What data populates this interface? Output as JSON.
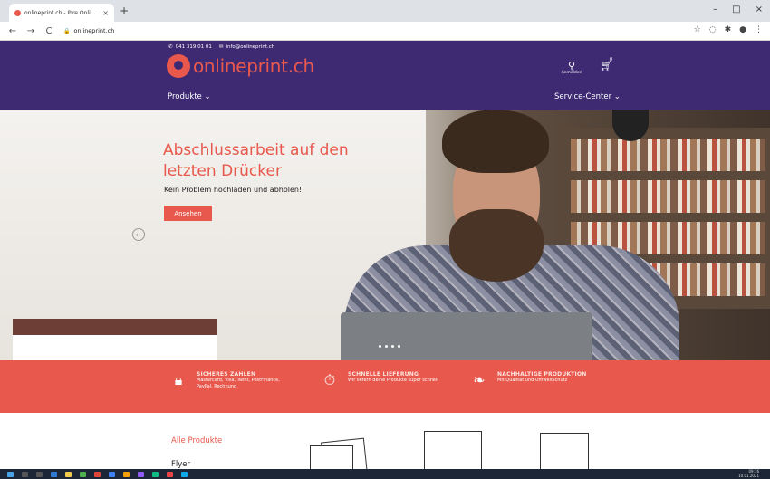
{
  "browser": {
    "tab_title": "onlineprint.ch - Ihre Onlinedruck",
    "tab_close": "×",
    "new_tab": "+",
    "url": "onlineprint.ch",
    "window_controls": [
      "–",
      "□",
      "×"
    ]
  },
  "header": {
    "phone": "041 319 01 01",
    "email": "info@onlineprint.ch",
    "logo_text": "onlineprint.ch",
    "account_label": "Anmelden",
    "cart_count": "0",
    "menu_products": "Produkte ⌄",
    "menu_service": "Service-Center ⌄"
  },
  "hero": {
    "title": "Abschlussarbeit auf den letzten Drücker",
    "subtitle": "Kein Problem hochladen und abholen!",
    "button": "Ansehen"
  },
  "features": [
    {
      "icon": "lock-icon",
      "title": "SICHERES ZAHLEN",
      "text": "Mastercard, Visa, Twint, PostFinance, PayPal, Rechnung"
    },
    {
      "icon": "stopwatch-icon",
      "title": "SCHNELLE LIEFERUNG",
      "text": "Wir liefern deine Produkte super schnell"
    },
    {
      "icon": "leaf-icon",
      "title": "NACHHALTIGE PRODUKTION",
      "text": "Mit Qualität und Umweltschutz"
    }
  ],
  "products": {
    "all_label": "Alle Produkte",
    "first_category": "Flyer"
  },
  "colors": {
    "brand_purple": "#3d2a72",
    "brand_coral": "#e8584c"
  },
  "taskbar": {
    "time": "09:16",
    "date": "10.01.2021"
  }
}
